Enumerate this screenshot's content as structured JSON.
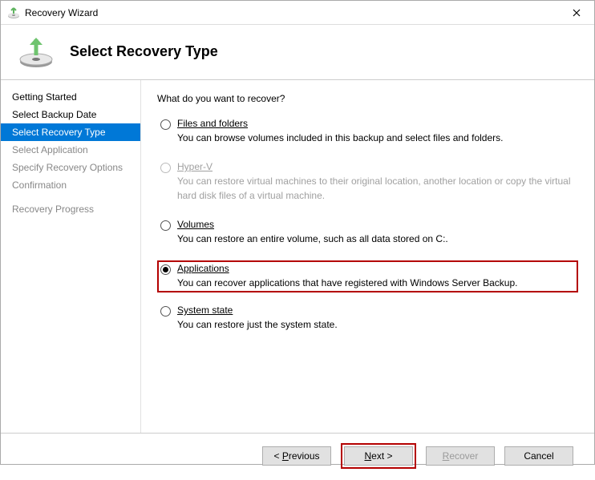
{
  "window": {
    "title": "Recovery Wizard"
  },
  "header": {
    "title": "Select Recovery Type"
  },
  "sidebar": {
    "items": [
      {
        "label": "Getting Started",
        "state": "done"
      },
      {
        "label": "Select Backup Date",
        "state": "done"
      },
      {
        "label": "Select Recovery Type",
        "state": "selected"
      },
      {
        "label": "Select Application",
        "state": "pending"
      },
      {
        "label": "Specify Recovery Options",
        "state": "pending"
      },
      {
        "label": "Confirmation",
        "state": "pending"
      },
      {
        "label": "Recovery Progress",
        "state": "pending"
      }
    ]
  },
  "main": {
    "prompt": "What do you want to recover?",
    "options": [
      {
        "label": "Files and folders",
        "desc": "You can browse volumes included in this backup and select files and folders.",
        "checked": false,
        "disabled": false
      },
      {
        "label": "Hyper-V",
        "desc": "You can restore virtual machines to their original location, another location or copy the virtual hard disk files of a virtual machine.",
        "checked": false,
        "disabled": true
      },
      {
        "label": "Volumes",
        "desc": "You can restore an entire volume, such as all data stored on C:.",
        "checked": false,
        "disabled": false
      },
      {
        "label": "Applications",
        "desc": "You can recover applications that have registered with Windows Server Backup.",
        "checked": true,
        "disabled": false,
        "highlighted": true
      },
      {
        "label": "System state",
        "desc": "You can restore just the system state.",
        "checked": false,
        "disabled": false
      }
    ]
  },
  "footer": {
    "previous": "< Previous",
    "next": "Next >",
    "recover": "Recover",
    "cancel": "Cancel"
  }
}
